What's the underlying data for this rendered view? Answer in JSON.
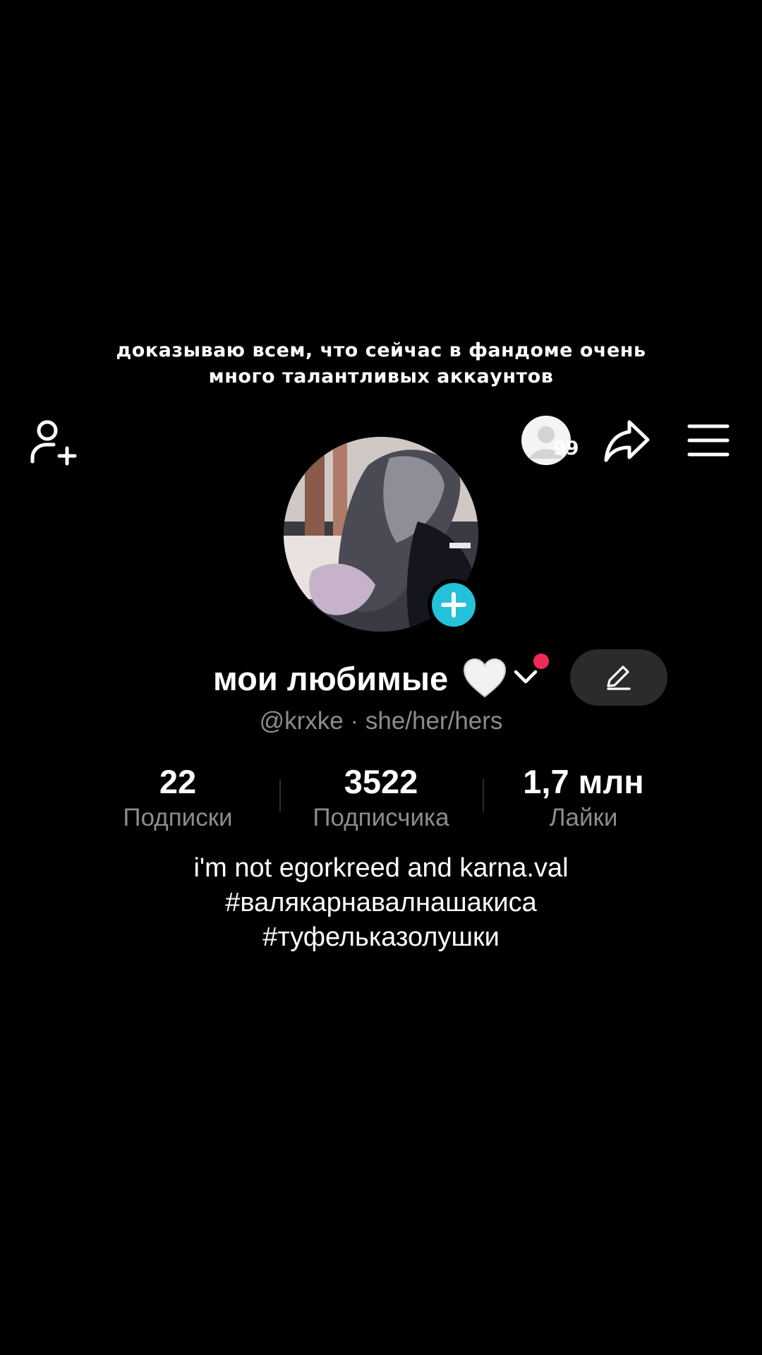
{
  "caption": {
    "line1": "доказываю всем, что сейчас в фандоме очень",
    "line2": "много талантливых аккаунтов"
  },
  "header": {
    "add_friend_icon": "person-add-icon",
    "visitors_icon": "profile-visitors-icon",
    "visitors_count": "99",
    "share_icon": "share-arrow-icon",
    "menu_icon": "hamburger-menu-icon"
  },
  "profile": {
    "display_name": "мои любимые",
    "name_emoji": "white-heart-icon",
    "handle": "@krxke · she/her/hers",
    "avatar_add_icon": "plus-icon",
    "edit_icon": "pencil-icon",
    "notification_dot_color": "#f02a56",
    "accent_color": "#24c2da"
  },
  "stats": {
    "following": {
      "value": "22",
      "label": "Подписки"
    },
    "followers": {
      "value": "3522",
      "label": "Подписчика"
    },
    "likes": {
      "value": "1,7 млн",
      "label": "Лайки"
    }
  },
  "bio": {
    "line1": "i'm not egorkreed and karna.val",
    "line2": "#валякарнавалнашакиса",
    "line3": "#туфельказолушки"
  }
}
